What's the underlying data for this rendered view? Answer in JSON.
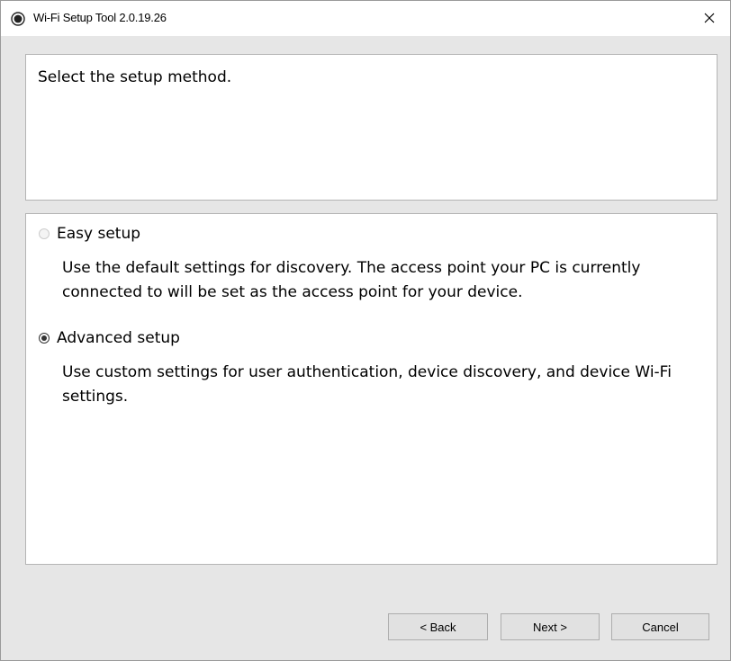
{
  "window": {
    "title": "Wi-Fi Setup Tool 2.0.19.26"
  },
  "header": {
    "instruction": "Select the setup method."
  },
  "options": [
    {
      "label": "Easy setup",
      "description": "Use the default settings for discovery. The access point your PC is currently connected to will be set as the access point for your device.",
      "selected": false,
      "enabled": false
    },
    {
      "label": "Advanced setup",
      "description": "Use custom settings for user authentication, device discovery, and device Wi-Fi settings.",
      "selected": true,
      "enabled": true
    }
  ],
  "buttons": {
    "back": "< Back",
    "next": "Next >",
    "cancel": "Cancel"
  },
  "icons": {
    "app": "radio-target-icon",
    "close": "close-icon"
  },
  "colors": {
    "client_bg": "#e6e6e6",
    "panel_bg": "#ffffff",
    "button_bg": "#e1e1e1"
  }
}
